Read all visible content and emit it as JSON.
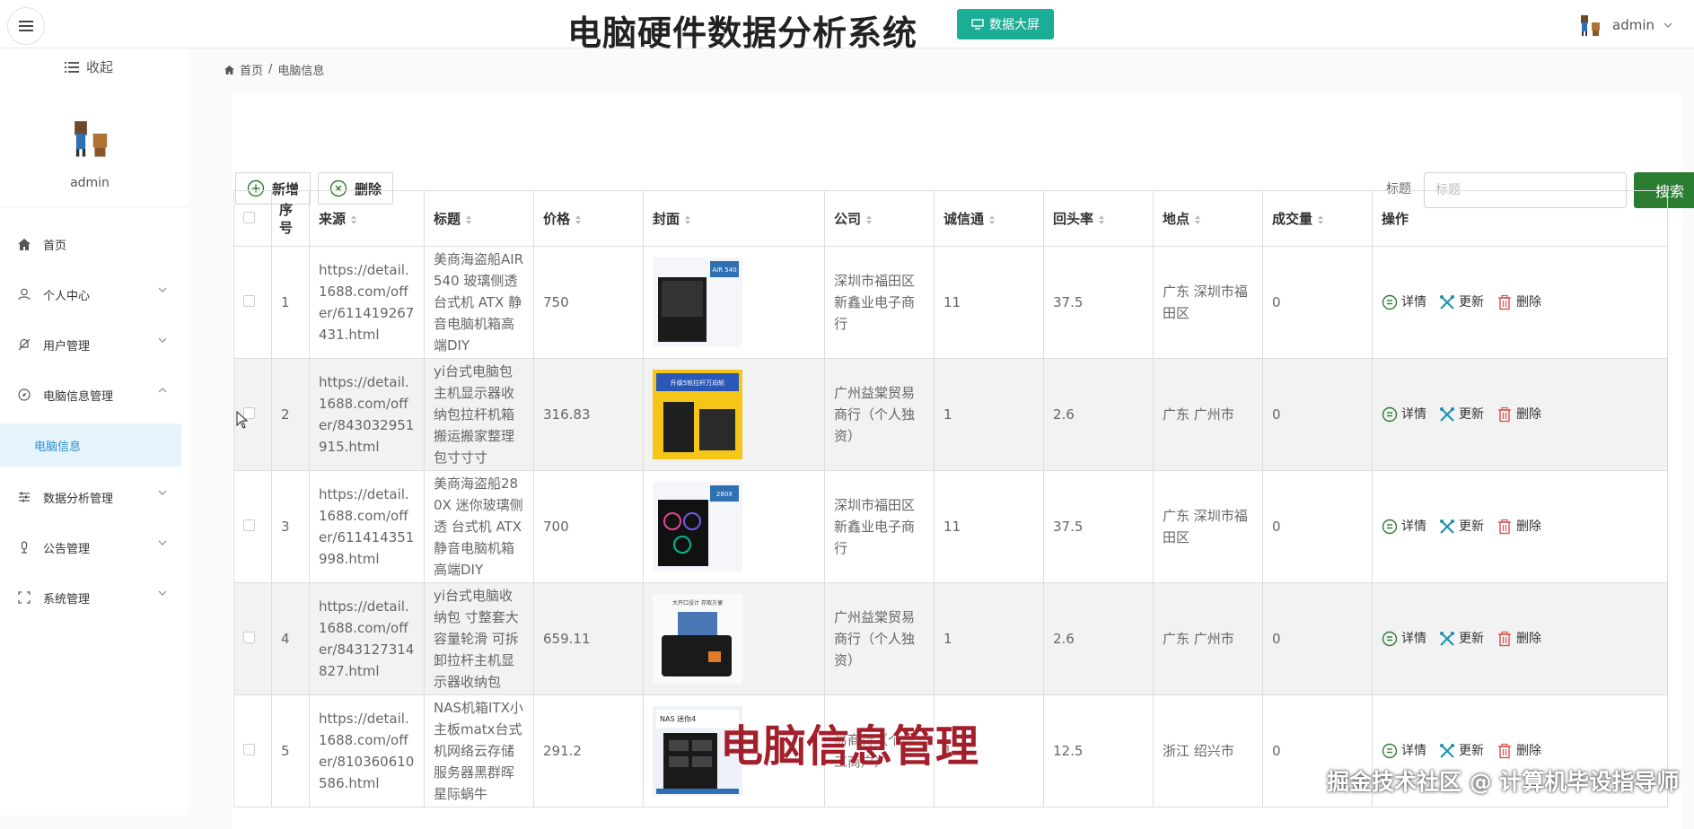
{
  "header": {
    "title": "电脑硬件数据分析系统",
    "dashboard_button": "数据大屏",
    "username": "admin"
  },
  "sidebar": {
    "collapse_label": "收起",
    "username": "admin",
    "items": [
      {
        "label": "首页",
        "icon": "home-icon"
      },
      {
        "label": "个人中心",
        "icon": "user-icon"
      },
      {
        "label": "用户管理",
        "icon": "bell-off-icon"
      },
      {
        "label": "电脑信息管理",
        "icon": "compass-icon"
      },
      {
        "label": "数据分析管理",
        "icon": "sliders-icon"
      },
      {
        "label": "公告管理",
        "icon": "mic-icon"
      },
      {
        "label": "系统管理",
        "icon": "expand-icon"
      }
    ],
    "active_sub": "电脑信息"
  },
  "breadcrumb": {
    "home": "首页",
    "separator": "/",
    "current": "电脑信息"
  },
  "toolbar": {
    "add_label": "新增",
    "delete_label": "删除",
    "search_label": "标题",
    "search_placeholder": "标题",
    "search_button": "搜索"
  },
  "table": {
    "headers": [
      "序号",
      "来源",
      "标题",
      "价格",
      "封面",
      "公司",
      "诚信通",
      "回头率",
      "地点",
      "成交量",
      "操作"
    ],
    "rows": [
      {
        "index": "1",
        "source": "https://detail.1688.com/offer/611419267431.html",
        "title": "美商海盗船AIR 540 玻璃侧透 台式机 ATX 静音电脑机箱高端DIY",
        "price": "750",
        "company": "深圳市福田区新鑫业电子商行",
        "trust": "11",
        "return_rate": "37.5",
        "location": "广东 深圳市福田区",
        "volume": "0",
        "cover_label": "AIR 540"
      },
      {
        "index": "2",
        "source": "https://detail.1688.com/offer/843032951915.html",
        "title": "yi台式电脑包主机显示器收纳包拉杆机箱搬运搬家整理包寸寸寸",
        "price": "316.83",
        "company": "广州益棠贸易商行（个人独资）",
        "trust": "1",
        "return_rate": "2.6",
        "location": "广东 广州市",
        "volume": "0",
        "cover_label": "升级5轮拉杆万向轮"
      },
      {
        "index": "3",
        "source": "https://detail.1688.com/offer/611414351998.html",
        "title": "美商海盗船280X 迷你玻璃侧透 台式机 ATX静音电脑机箱高端DIY",
        "price": "700",
        "company": "深圳市福田区新鑫业电子商行",
        "trust": "11",
        "return_rate": "37.5",
        "location": "广东 深圳市福田区",
        "volume": "0",
        "cover_label": "280X"
      },
      {
        "index": "4",
        "source": "https://detail.1688.com/offer/843127314827.html",
        "title": "yi台式电脑收纳包 寸整套大容量轮滑 可拆卸拉杆主机显示器收纳包",
        "price": "659.11",
        "company": "广州益棠贸易商行（个人独资）",
        "trust": "1",
        "return_rate": "2.6",
        "location": "广东 广州市",
        "volume": "0",
        "cover_label": "大开口设计 存取方便"
      },
      {
        "index": "5",
        "source": "https://detail.1688.com/offer/810360610586.html",
        "title": "NAS机箱ITX小主板matx台式机网络云存储服务器黑群晖星际蜗牛",
        "price": "291.2",
        "company": "易商行（个体工商户）",
        "trust": "1",
        "return_rate": "12.5",
        "location": "浙江 绍兴市",
        "volume": "0",
        "cover_label": "NAS 迷你4"
      }
    ],
    "actions": {
      "detail": "详情",
      "update": "更新",
      "delete": "删除"
    }
  },
  "overlays": {
    "caption": "电脑信息管理",
    "watermark": "掘金技术社区 @ 计算机毕设指导师"
  },
  "colors": {
    "accent_teal": "#1aae97",
    "search_green": "#2a7d31",
    "active_blue": "#2e8ccf",
    "caption_red": "#a21f2b"
  }
}
